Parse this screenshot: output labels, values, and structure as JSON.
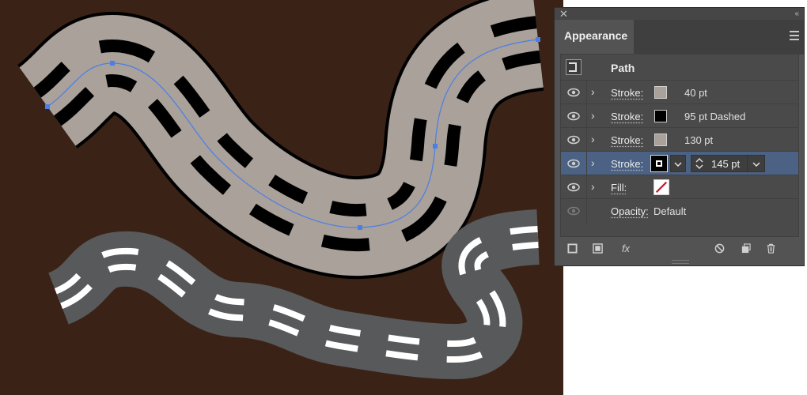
{
  "panel": {
    "tab_label": "Appearance",
    "path_label": "Path",
    "rows": [
      {
        "label": "Stroke:",
        "value": "40 pt",
        "swatch": "#a9a19a"
      },
      {
        "label": "Stroke:",
        "value": "95 pt Dashed",
        "swatch": "#000000"
      },
      {
        "label": "Stroke:",
        "value": "130 pt",
        "swatch": "#a9a19a"
      },
      {
        "label": "Stroke:",
        "value": "145 pt",
        "swatch": "#000000"
      },
      {
        "label": "Fill:",
        "value": "",
        "swatch": "none"
      }
    ],
    "opacity_label": "Opacity:",
    "opacity_value": "Default",
    "toolbar_icons": [
      "add-stroke-icon",
      "add-fill-icon",
      "fx-icon",
      "clear-appearance-icon",
      "duplicate-item-icon",
      "delete-icon"
    ],
    "fx_label": "fx"
  },
  "colors": {
    "canvas_bg": "#3a2216",
    "road_light": "#a9a19a",
    "road_dark": "#58595b",
    "selection": "#4a7ee8",
    "selected_row": "#4b6284"
  }
}
